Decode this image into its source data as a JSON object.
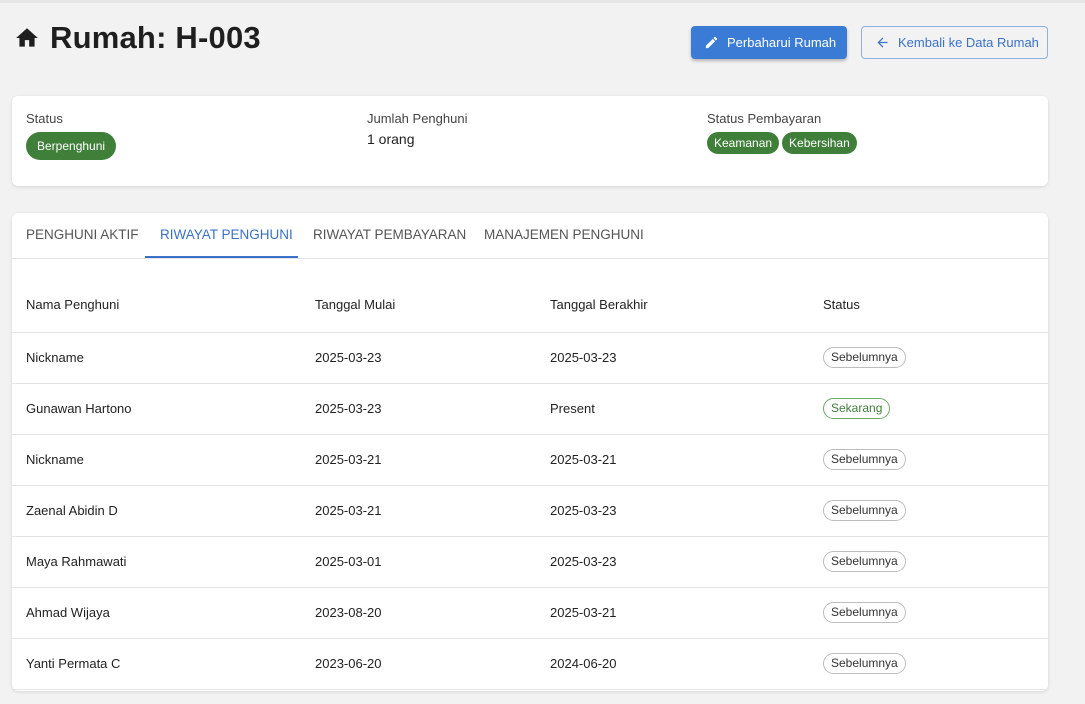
{
  "header": {
    "title": "Rumah: H-003",
    "update_label": "Perbaharui Rumah",
    "back_label": "Kembali ke Data Rumah"
  },
  "summary": {
    "status_label": "Status",
    "status_value": "Berpenghuni",
    "occupants_label": "Jumlah Penghuni",
    "occupants_value": "1 orang",
    "payment_label": "Status Pembayaran",
    "payment_chips": [
      "Keamanan",
      "Kebersihan"
    ]
  },
  "tabs": [
    {
      "label": "PENGHUNI AKTIF"
    },
    {
      "label": "RIWAYAT PENGHUNI"
    },
    {
      "label": "RIWAYAT PEMBAYARAN"
    },
    {
      "label": "MANAJEMEN PENGHUNI"
    }
  ],
  "table": {
    "columns": [
      "Nama Penghuni",
      "Tanggal Mulai",
      "Tanggal Berakhir",
      "Status"
    ],
    "rows": [
      {
        "name": "Nickname",
        "start": "2025-03-23",
        "end": "2025-03-23",
        "status": "Sebelumnya"
      },
      {
        "name": "Gunawan Hartono",
        "start": "2025-03-23",
        "end": "Present",
        "status": "Sekarang"
      },
      {
        "name": "Nickname",
        "start": "2025-03-21",
        "end": "2025-03-21",
        "status": "Sebelumnya"
      },
      {
        "name": "Zaenal Abidin D",
        "start": "2025-03-21",
        "end": "2025-03-23",
        "status": "Sebelumnya"
      },
      {
        "name": "Maya Rahmawati",
        "start": "2025-03-01",
        "end": "2025-03-23",
        "status": "Sebelumnya"
      },
      {
        "name": "Ahmad Wijaya",
        "start": "2023-08-20",
        "end": "2025-03-21",
        "status": "Sebelumnya"
      },
      {
        "name": "Yanti Permata C",
        "start": "2023-06-20",
        "end": "2024-06-20",
        "status": "Sebelumnya"
      }
    ]
  }
}
